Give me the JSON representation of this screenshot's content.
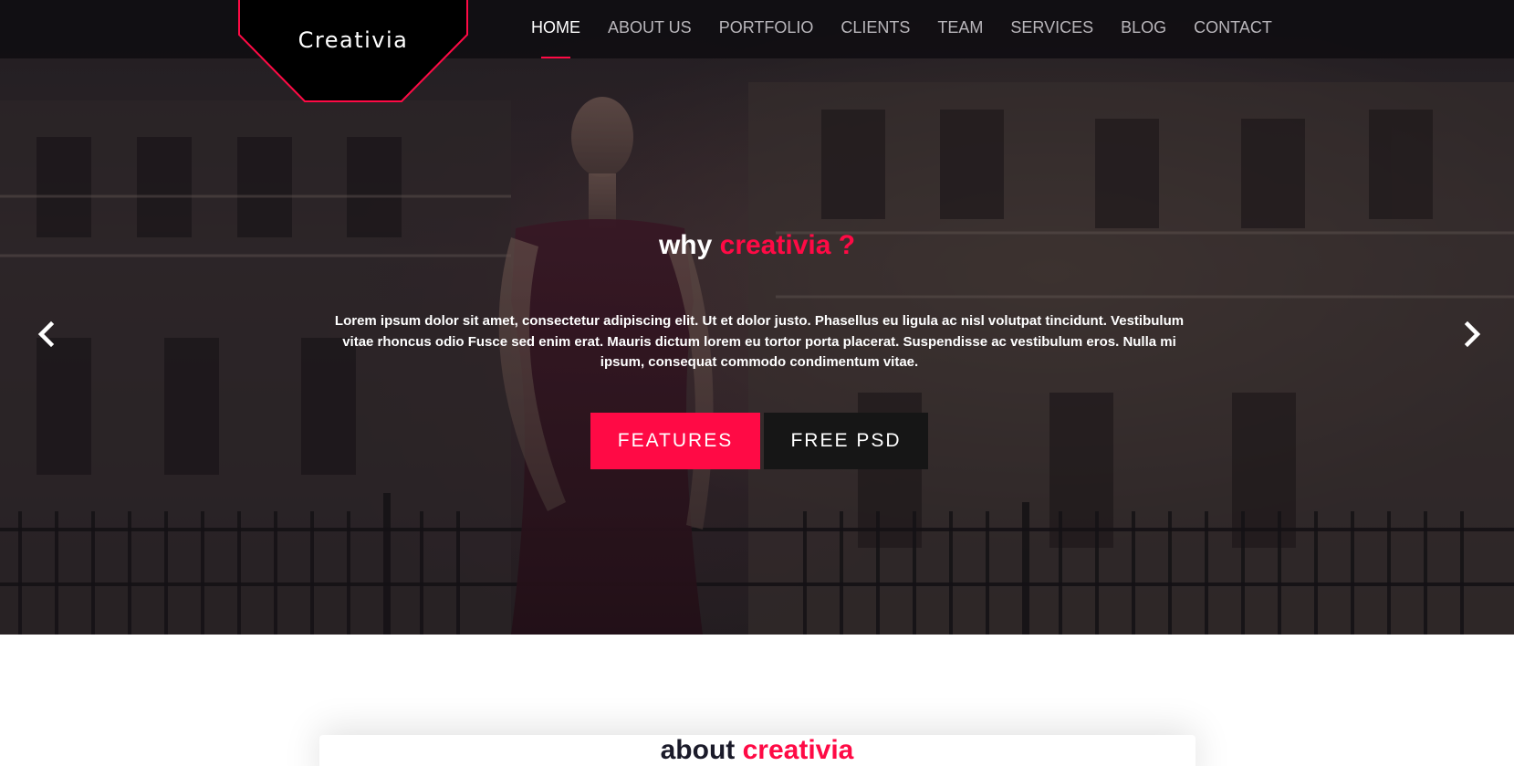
{
  "brand": {
    "name": "Creativia"
  },
  "nav": {
    "items": [
      {
        "label": "HOME",
        "active": true
      },
      {
        "label": "ABOUT US"
      },
      {
        "label": "PORTFOLIO"
      },
      {
        "label": "CLIENTS"
      },
      {
        "label": "TEAM"
      },
      {
        "label": "SERVICES"
      },
      {
        "label": "BLOG"
      },
      {
        "label": "CONTACT"
      }
    ]
  },
  "hero": {
    "heading_plain": "why",
    "heading_accent": "creativia ?",
    "text": "Lorem ipsum dolor sit amet, consectetur adipiscing elit. Ut et dolor justo. Phasellus eu ligula ac nisl volutpat tincidunt. Vestibulum vitae rhoncus odio Fusce sed enim erat. Mauris dictum lorem eu tortor porta placerat. Suspendisse ac vestibulum eros. Nulla mi ipsum, consequat commodo condimentum vitae.",
    "primary_button": "FEATURES",
    "secondary_button": "FREE PSD",
    "prev_icon": "chevron-left-icon",
    "next_icon": "chevron-right-icon"
  },
  "about": {
    "heading_plain": "about",
    "heading_accent": "creativia"
  },
  "colors": {
    "accent": "#ff0a45",
    "navbar": "#100e12",
    "dark_button": "#161616",
    "heading_dark": "#1b1b2a"
  }
}
